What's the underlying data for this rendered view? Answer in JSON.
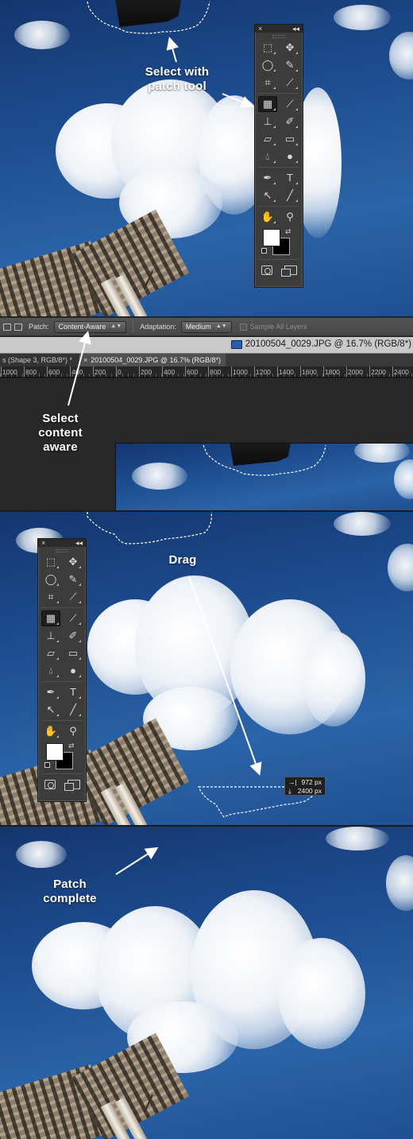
{
  "annotations": {
    "step1_select": "Select with",
    "step1_tool": "patch tool",
    "step2_line1": "Select",
    "step2_line2": "content",
    "step2_line3": "aware",
    "step3_drag": "Drag",
    "step4_line1": "Patch",
    "step4_line2": "complete"
  },
  "options_bar": {
    "patch_label": "Patch:",
    "patch_value": "Content-Aware",
    "adaptation_label": "Adaptation:",
    "adaptation_value": "Medium",
    "sample_all_layers": "Sample All Layers"
  },
  "document": {
    "title": "20100504_0029.JPG @ 16.7% (RGB/8*)",
    "tab_other": "s (Shape 3, RGB/8*) *",
    "tab_active": "20100504_0029.JPG @ 16.7% (RGB/8*)",
    "tab_close": "×"
  },
  "ruler": {
    "labels": [
      "1000",
      "800",
      "600",
      "400",
      "200",
      "0",
      "200",
      "400",
      "600",
      "800",
      "1000",
      "1200",
      "1400",
      "1600",
      "1800",
      "2000",
      "2200",
      "2400"
    ]
  },
  "drag_readout": {
    "x_icon": "→|",
    "x_value": "972 px",
    "y_icon": "⤓",
    "y_value": "2400 px"
  },
  "toolbox": {
    "close": "×",
    "collapse": "◂◂"
  },
  "colors": {
    "sky_dark": "#14366f",
    "sky_light": "#2a64a8",
    "panel_bg": "#3c3c3c",
    "options_bar": "#4d4d4d"
  }
}
